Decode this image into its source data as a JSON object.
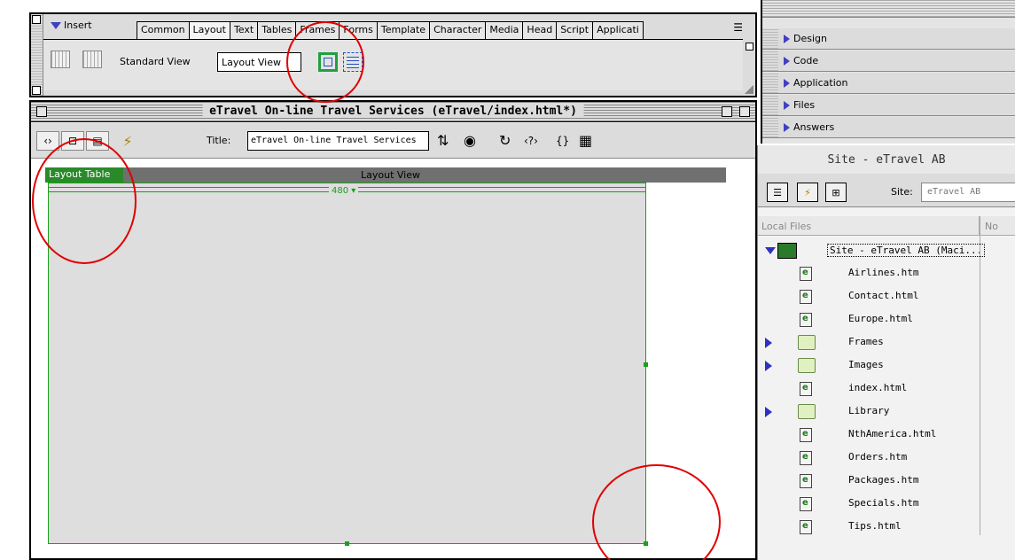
{
  "insert_bar": {
    "title": "Insert",
    "tabs": [
      "Common",
      "Layout",
      "Text",
      "Tables",
      "Frames",
      "Forms",
      "Template",
      "Character",
      "Media",
      "Head",
      "Script",
      "Applicati"
    ],
    "active_tab": "Layout",
    "standard_view_label": "Standard View",
    "layout_view_label": "Layout View"
  },
  "document": {
    "title": "eTravel On-line Travel Services (eTravel/index.html*)",
    "title_label": "Title:",
    "title_value": "eTravel On-line Travel Services",
    "layout_table_tab": "Layout Table",
    "layout_view_label": "Layout View",
    "table_width": "480 ▾"
  },
  "panels": {
    "items": [
      "Design",
      "Code",
      "Application",
      "Files",
      "Answers"
    ]
  },
  "site": {
    "panel_title": "Site - eTravel AB",
    "site_label": "Site:",
    "site_value": "eTravel AB",
    "column_local_files": "Local Files",
    "column_notes": "No",
    "root": "Site - eTravel AB (Maci...",
    "files": [
      {
        "name": "Airlines.htm",
        "kind": "file"
      },
      {
        "name": "Contact.html",
        "kind": "file"
      },
      {
        "name": "Europe.html",
        "kind": "file"
      },
      {
        "name": "Frames",
        "kind": "folder"
      },
      {
        "name": "Images",
        "kind": "folder"
      },
      {
        "name": "index.html",
        "kind": "file"
      },
      {
        "name": "Library",
        "kind": "folder"
      },
      {
        "name": "NthAmerica.html",
        "kind": "file"
      },
      {
        "name": "Orders.htm",
        "kind": "file"
      },
      {
        "name": "Packages.htm",
        "kind": "file"
      },
      {
        "name": "Specials.htm",
        "kind": "file"
      },
      {
        "name": "Tips.html",
        "kind": "file"
      }
    ]
  },
  "colors": {
    "annotation": "#e00000",
    "layout_green": "#1aa01a",
    "twisty_blue": "#3030c0"
  }
}
